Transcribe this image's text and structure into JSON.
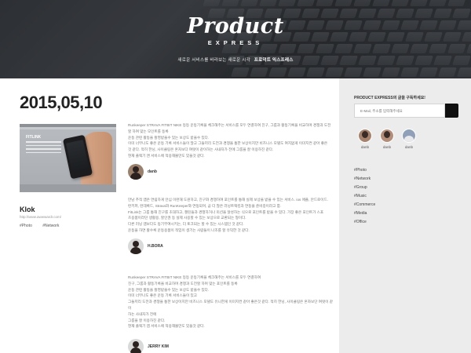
{
  "hero": {
    "logo": "Product",
    "logo_sub": "EXPRESS",
    "tagline": "새로운 서비스를 바라보는 새로운 시각",
    "tagline_bold": "프로덕트 익스프레스"
  },
  "main": {
    "date": "2015,05,10",
    "thumbnail": {
      "title": "FITLINK",
      "icon": "phone-in-hand-image"
    },
    "post": {
      "title": "Klok",
      "url": "http://www.awwwardr.com/",
      "tags": [
        "#Photo",
        "#Network"
      ]
    },
    "comments": [
      {
        "lines": [
          "Runkeeper STRAVA FITBIT NIKE 등등 운동기록을 체크해주는 서비스를 모두 연결하여 친구, 그룹과 활동기록을 비교하며 경쟁과 도전",
          "할 하여 맞는 모인트를 동록",
          "운동 관련 활동을 촬영받을수 있는 보상도 받을수 있다.",
          "이미 너무나도 좋은 운동 기록 서비스들이 많고 그들끼리 도전과 경쟁을 통한 보상이지만 비즈니스 모델도 여지없게 이미지컨 같아 좋은",
          "것 같다. 적히 한닝, 사이클링은 혼자보다 여럿이 같이하는 사내자가 전에 그룹을 잘 이용하진 같다.",
          "현재 플렉기 앤 서비스에 적용해볼만도 있을것 같다."
        ],
        "author": "danb"
      },
      {
        "lines": [
          "만남 추적 앱은 연림하게 안심 이런해 도원하고, 친구와 경쟁하여 포인트를 통해 실제 보상을 받을 수 있는 서비스. ios 애플, 안드로이드.",
          "런키퍼, 런데록드, Strava와 RunKeeper와 연동되며, 곧 더 많은 러닝트랙킹과 연동을 준비중이라고 함.",
          "FitLink는 그룹 통해 친구를 초대하고, 챌린들과 경쟁하거나 미션을 달성하는 식으로 포인트를 받을 수 있다. 가장 좋은 포인트가 스포",
          "츠용품이라던 생활용, 할인권 등 실제 사용할 수 있는 보상으로 교환되는 형이다.",
          "다른 러닝 앱보다도 동기부여시키는, 더 토크되는 할 수 있는 시스템인 것 같다.",
          "운동을 하면 활수록 운동용품이 적입이 생기는 사람들이 나조를 할 유익한 것 같다."
        ],
        "author": "H.BORA"
      },
      {
        "lines": [
          "Runkeeper STRAVA FITBIT NIKE 등등 운동기록을 체크해주는 서비스를 모두 연결하여",
          "친구, 그룹과 활동기록을 비교하며 경쟁과 도전할 하며 맞는 포인트를 동록",
          "운동 관련 활동을 촬영받을수 있는 보상도 받을수 있다.",
          "이미 너무나도 좋은 운동 기록 서비스들이 있고",
          "그들끼리 도전과 경쟁을 통한 보상이지만 비즈니스 모델도 유니한게 이미지컨 같아 좋은것 같다. 적히 한닝, 사이클링은 혼자보단 여럿이 같이",
          "하는 사내자가 전에",
          "그룹을 잘 이용하진 같다.",
          "현재 플렉기 앱 서비스에 적용해볼만도 있을것 같다."
        ],
        "author": "JERRY KIM"
      }
    ]
  },
  "sidebar": {
    "subscribe_title": "PRODUCT EXPRESS의 글을 구독하세요!",
    "email_placeholder": "E-Mail, 주소를 입력해주세요",
    "members": [
      {
        "name": "danb"
      },
      {
        "name": "danb"
      },
      {
        "name": "danb"
      }
    ],
    "tags": [
      "#Photo",
      "#Network",
      "#Group",
      "#Music",
      "#Commerce",
      "#Media",
      "#Office"
    ]
  }
}
